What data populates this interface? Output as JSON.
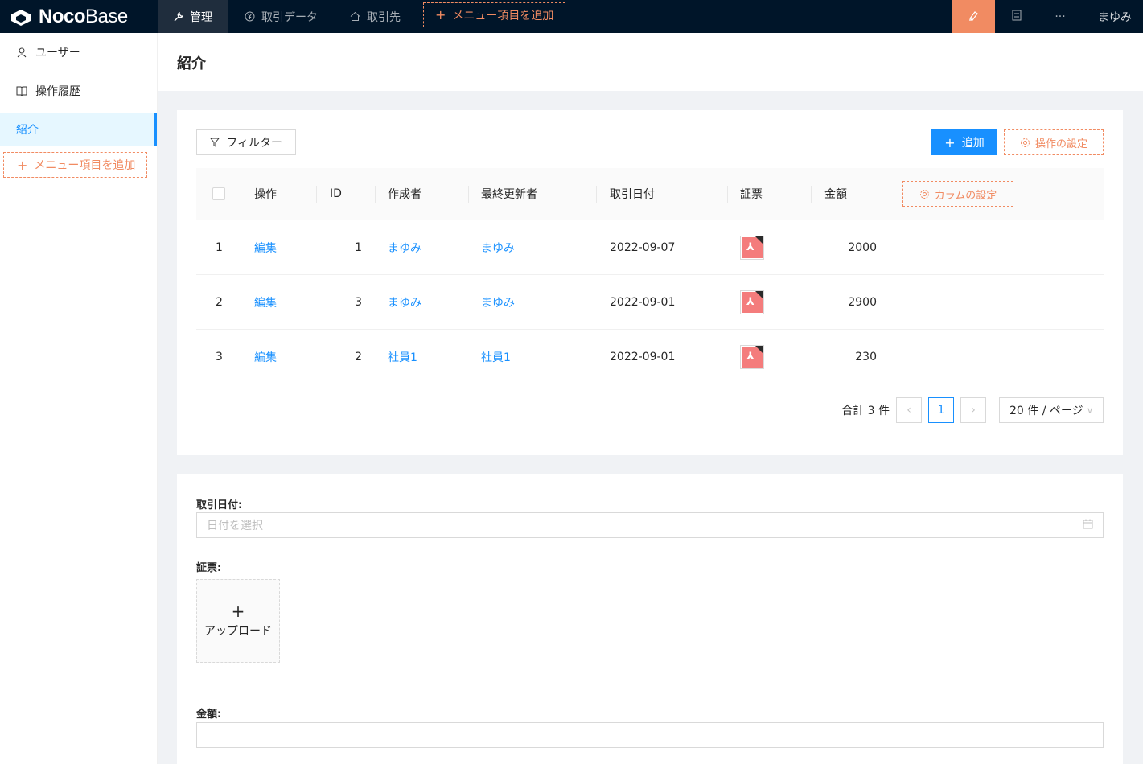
{
  "header": {
    "logo_noco": "Noco",
    "logo_base": "Base",
    "nav": [
      {
        "label": "管理",
        "icon": "wrench-icon"
      },
      {
        "label": "取引データ",
        "icon": "yen-circle-icon"
      },
      {
        "label": "取引先",
        "icon": "home-icon"
      }
    ],
    "add_menu": "メニュー項目を追加",
    "user": "まゆみ",
    "more": "···"
  },
  "sidebar": {
    "items": [
      {
        "label": "ユーザー",
        "icon": "user-icon"
      },
      {
        "label": "操作履歴",
        "icon": "book-icon"
      },
      {
        "label": "紹介",
        "icon": ""
      }
    ],
    "add_menu": "メニュー項目を追加"
  },
  "page": {
    "title": "紹介"
  },
  "toolbar": {
    "filter": "フィルター",
    "add": "追加",
    "action_settings": "操作の設定"
  },
  "table": {
    "columns": [
      "操作",
      "ID",
      "作成者",
      "最終更新者",
      "取引日付",
      "証票",
      "金額"
    ],
    "column_settings": "カラムの設定",
    "rows": [
      {
        "no": "1",
        "action": "編集",
        "id": "1",
        "creator": "まゆみ",
        "updater": "まゆみ",
        "date": "2022-09-07",
        "amount": "2000"
      },
      {
        "no": "2",
        "action": "編集",
        "id": "3",
        "creator": "まゆみ",
        "updater": "まゆみ",
        "date": "2022-09-01",
        "amount": "2900"
      },
      {
        "no": "3",
        "action": "編集",
        "id": "2",
        "creator": "社員1",
        "updater": "社員1",
        "date": "2022-09-01",
        "amount": "230"
      }
    ]
  },
  "pagination": {
    "total": "合計 3 件",
    "current": "1",
    "page_size": "20 件 / ページ"
  },
  "form": {
    "date_label": "取引日付:",
    "date_placeholder": "日付を選択",
    "voucher_label": "証票:",
    "upload": "アップロード",
    "amount_label": "金額:"
  },
  "colors": {
    "accent": "#1890ff",
    "design": "#f18b62",
    "header_bg": "#001529"
  }
}
